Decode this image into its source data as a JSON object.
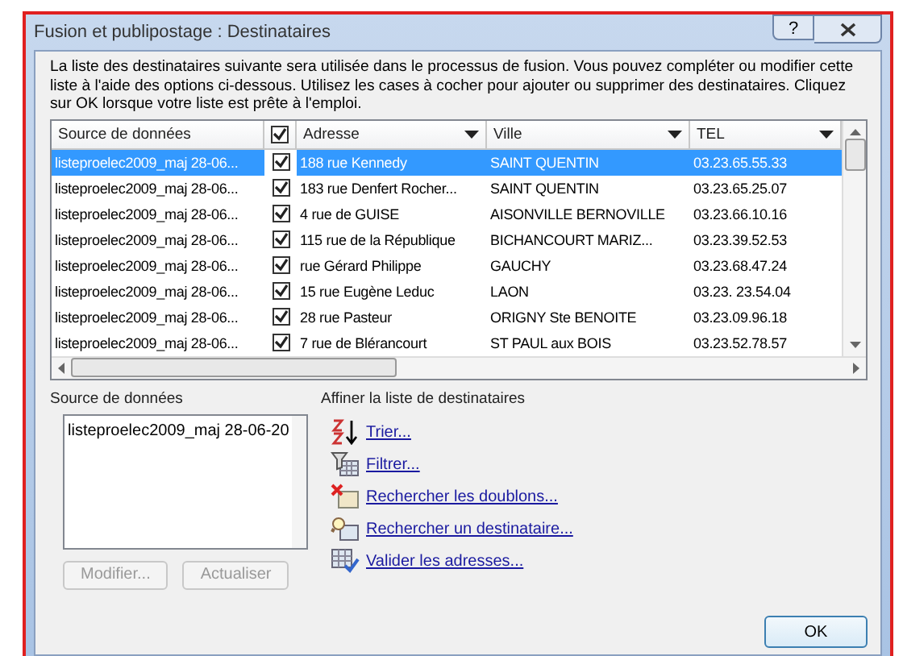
{
  "window": {
    "title": "Fusion et publipostage : Destinataires",
    "help_button": "?"
  },
  "intro": "La liste des destinataires suivante sera utilisée dans le processus de fusion. Vous pouvez compléter ou modifier cette liste à l'aide des options ci-dessous. Utilisez les cases à cocher pour ajouter ou supprimer des destinataires. Cliquez sur OK lorsque votre liste est prête à l'emploi.",
  "table": {
    "columns": [
      {
        "label": "Source de données",
        "kind": "text",
        "dropdown": false
      },
      {
        "kind": "check",
        "checked": true
      },
      {
        "label": "Adresse",
        "kind": "text",
        "dropdown": true
      },
      {
        "label": "Ville",
        "kind": "text",
        "dropdown": true
      },
      {
        "label": "TEL",
        "kind": "text",
        "dropdown": true
      }
    ],
    "rows": [
      {
        "source": "listeproelec2009_maj 28-06...",
        "checked": true,
        "adresse": "188 rue Kennedy",
        "ville": "SAINT QUENTIN",
        "tel": "03.23.65.55.33",
        "selected": true
      },
      {
        "source": "listeproelec2009_maj 28-06...",
        "checked": true,
        "adresse": "183 rue Denfert Rocher...",
        "ville": "SAINT QUENTIN",
        "tel": "03.23.65.25.07",
        "selected": false
      },
      {
        "source": "listeproelec2009_maj 28-06...",
        "checked": true,
        "adresse": "4 rue de GUISE",
        "ville": "AISONVILLE BERNOVILLE",
        "tel": "03.23.66.10.16",
        "selected": false
      },
      {
        "source": "listeproelec2009_maj 28-06...",
        "checked": true,
        "adresse": "115 rue de la République",
        "ville": "BICHANCOURT MARIZ...",
        "tel": "03.23.39.52.53",
        "selected": false
      },
      {
        "source": "listeproelec2009_maj 28-06...",
        "checked": true,
        "adresse": "rue Gérard Philippe",
        "ville": "GAUCHY",
        "tel": "03.23.68.47.24",
        "selected": false
      },
      {
        "source": "listeproelec2009_maj 28-06...",
        "checked": true,
        "adresse": "15  rue Eugène Leduc",
        "ville": "LAON",
        "tel": "03.23. 23.54.04",
        "selected": false
      },
      {
        "source": "listeproelec2009_maj 28-06...",
        "checked": true,
        "adresse": "28 rue Pasteur",
        "ville": "ORIGNY Ste BENOITE",
        "tel": "03.23.09.96.18",
        "selected": false
      },
      {
        "source": "listeproelec2009_maj 28-06...",
        "checked": true,
        "adresse": "7 rue de Blérancourt",
        "ville": "ST PAUL aux BOIS",
        "tel": "03.23.52.78.57",
        "selected": false
      }
    ]
  },
  "source_panel": {
    "title": "Source de données",
    "items": [
      "listeproelec2009_maj 28-06-20"
    ],
    "buttons": [
      {
        "label": "Modifier...",
        "disabled": true
      },
      {
        "label": "Actualiser",
        "disabled": true
      }
    ]
  },
  "refine_panel": {
    "title": "Affiner la liste de destinataires",
    "links": [
      {
        "label": "Trier...",
        "kind": "sort"
      },
      {
        "label": "Filtrer...",
        "kind": "filter"
      },
      {
        "label": "Rechercher les doublons...",
        "kind": "duplicates"
      },
      {
        "label": "Rechercher un destinataire...",
        "kind": "find"
      },
      {
        "label": "Valider les adresses...",
        "kind": "validate"
      }
    ]
  },
  "ok_button": "OK"
}
